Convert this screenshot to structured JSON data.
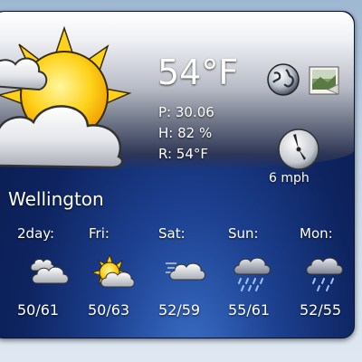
{
  "current": {
    "temperature": "54°F",
    "pressure": "P: 30.06",
    "humidity": "H: 82 %",
    "realfeel": "R: 54°F",
    "wind_speed": "6 mph",
    "city": "Wellington",
    "condition_icon": "sun-behind-clouds-icon"
  },
  "buttons": {
    "globe_icon": "globe-icon",
    "photo_icon": "photo-icon"
  },
  "forecast": [
    {
      "day": "2day:",
      "range": "50/61",
      "icon": "clouds-icon"
    },
    {
      "day": "Fri:",
      "range": "50/63",
      "icon": "partly-sunny-icon"
    },
    {
      "day": "Sat:",
      "range": "52/59",
      "icon": "windy-cloud-icon"
    },
    {
      "day": "Sun:",
      "range": "55/61",
      "icon": "rain-icon"
    },
    {
      "day": "Mon:",
      "range": "52/55",
      "icon": "rain-icon"
    }
  ],
  "colors": {
    "panel_top": "#eef0f4",
    "panel_bottom": "#0e2460",
    "sun": "#ffd21a",
    "text": "#ffffff"
  }
}
